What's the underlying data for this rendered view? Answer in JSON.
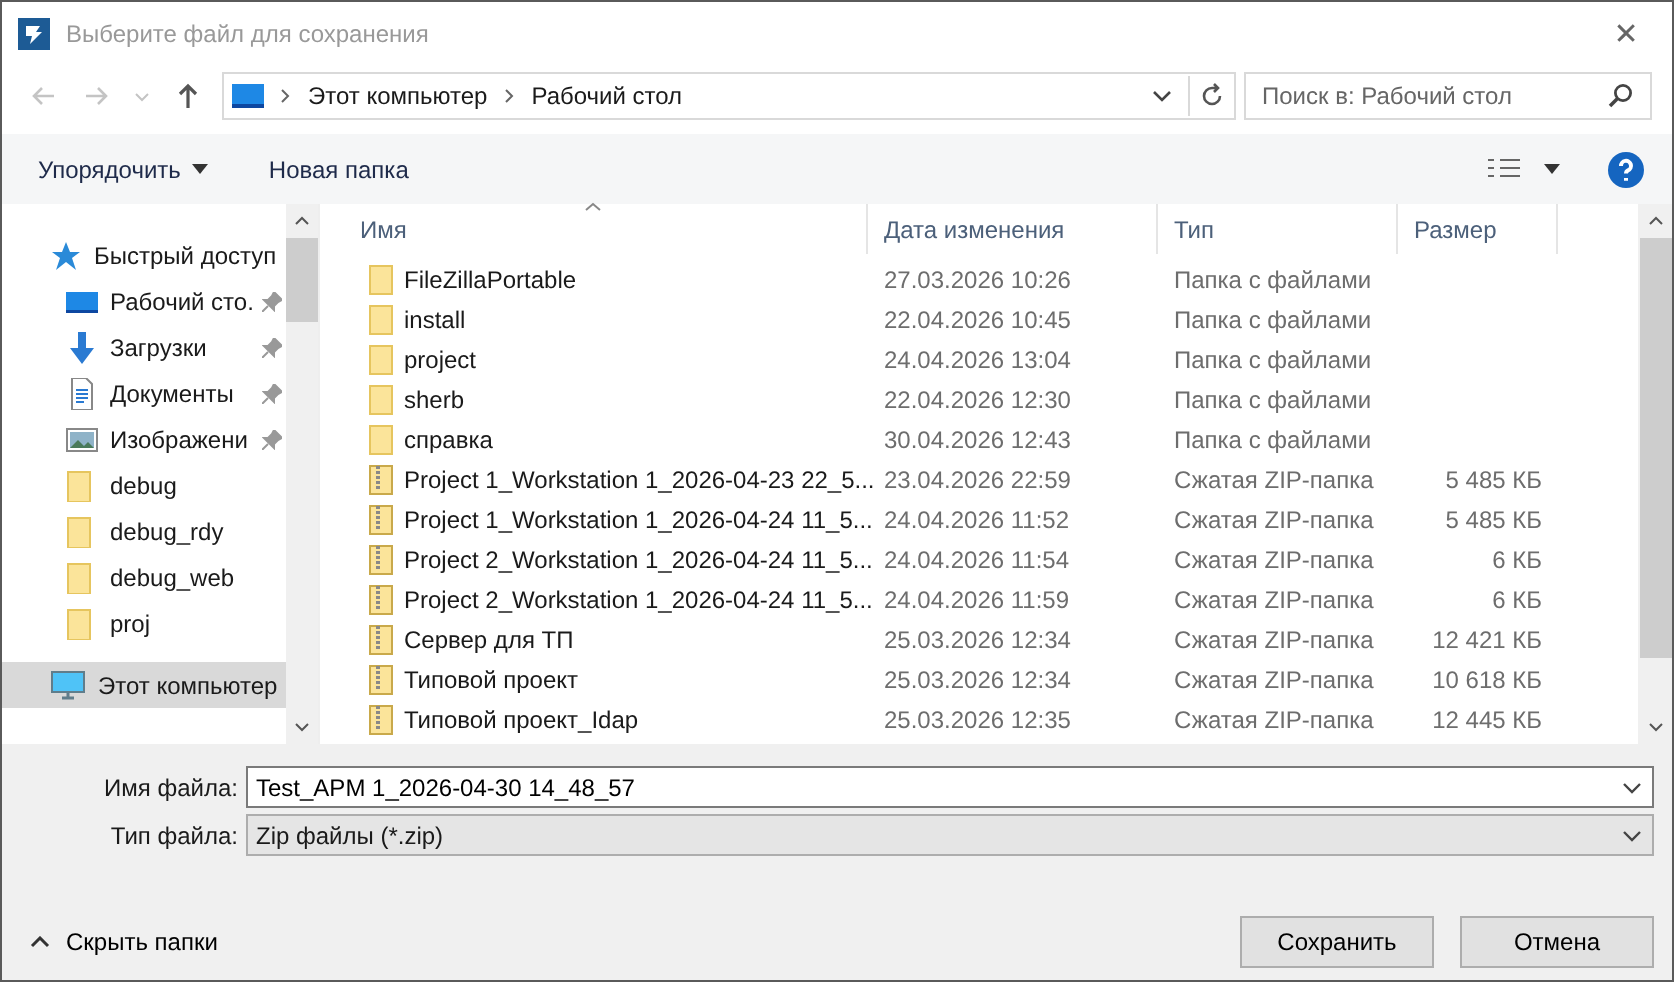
{
  "window": {
    "title": "Выберите файл для сохранения",
    "close": "✕"
  },
  "address": {
    "path": [
      "Этот компьютер",
      "Рабочий стол"
    ]
  },
  "search": {
    "placeholder": "Поиск в: Рабочий стол"
  },
  "toolbar": {
    "organize": "Упорядочить",
    "new_folder": "Новая папка"
  },
  "sidebar": {
    "items": [
      {
        "label": "Быстрый доступ",
        "kind": "star",
        "pinned": false,
        "selected": false
      },
      {
        "label": "Рабочий сто.",
        "kind": "desktop",
        "pinned": true,
        "selected": false
      },
      {
        "label": "Загрузки",
        "kind": "download",
        "pinned": true,
        "selected": false
      },
      {
        "label": "Документы",
        "kind": "document",
        "pinned": true,
        "selected": false
      },
      {
        "label": "Изображени",
        "kind": "image",
        "pinned": true,
        "selected": false
      },
      {
        "label": "debug",
        "kind": "folder",
        "pinned": false,
        "selected": false
      },
      {
        "label": "debug_rdy",
        "kind": "folder",
        "pinned": false,
        "selected": false
      },
      {
        "label": "debug_web",
        "kind": "folder",
        "pinned": false,
        "selected": false
      },
      {
        "label": "proj",
        "kind": "folder",
        "pinned": false,
        "selected": false
      },
      {
        "label": "Этот компьютер",
        "kind": "computer",
        "pinned": false,
        "selected": true
      }
    ]
  },
  "table": {
    "columns": [
      "Имя",
      "Дата изменения",
      "Тип",
      "Размер"
    ],
    "rows": [
      {
        "kind": "folder",
        "name": "FileZillaPortable",
        "date": "27.03.2026 10:26",
        "type": "Папка с файлами"
      },
      {
        "kind": "folder",
        "name": "install",
        "date": "22.04.2026 10:45",
        "type": "Папка с файлами"
      },
      {
        "kind": "folder",
        "name": "project",
        "date": "24.04.2026 13:04",
        "type": "Папка с файлами"
      },
      {
        "kind": "folder",
        "name": "sherb",
        "date": "22.04.2026 12:30",
        "type": "Папка с файлами"
      },
      {
        "kind": "folder",
        "name": "справка",
        "date": "30.04.2026 12:43",
        "type": "Папка с файлами"
      },
      {
        "kind": "zip",
        "name": "Project 1_Workstation 1_2026-04-23 22_5...",
        "date": "23.04.2026 22:59",
        "type": "Сжатая ZIP-папка",
        "size": "5 485 КБ"
      },
      {
        "kind": "zip",
        "name": "Project 1_Workstation 1_2026-04-24 11_5...",
        "date": "24.04.2026 11:52",
        "type": "Сжатая ZIP-папка",
        "size": "5 485 КБ"
      },
      {
        "kind": "zip",
        "name": "Project 2_Workstation 1_2026-04-24 11_5...",
        "date": "24.04.2026 11:54",
        "type": "Сжатая ZIP-папка",
        "size": "6 КБ"
      },
      {
        "kind": "zip",
        "name": "Project 2_Workstation 1_2026-04-24 11_5...",
        "date": "24.04.2026 11:59",
        "type": "Сжатая ZIP-папка",
        "size": "6 КБ"
      },
      {
        "kind": "zip",
        "name": "Сервер для ТП",
        "date": "25.03.2026 12:34",
        "type": "Сжатая ZIP-папка",
        "size": "12 421 КБ"
      },
      {
        "kind": "zip",
        "name": "Типовой проект",
        "date": "25.03.2026 12:34",
        "type": "Сжатая ZIP-папка",
        "size": "10 618 КБ"
      },
      {
        "kind": "zip",
        "name": "Типовой проект_Idap",
        "date": "25.03.2026 12:35",
        "type": "Сжатая ZIP-папка",
        "size": "12 445 КБ"
      }
    ]
  },
  "file_name": {
    "label": "Имя файла:",
    "value": "Test_APM 1_2026-04-30 14_48_57"
  },
  "file_type": {
    "label": "Тип файла:",
    "value": "Zip файлы (*.zip)"
  },
  "footer": {
    "hide_folders": "Скрыть папки",
    "save": "Сохранить",
    "cancel": "Отмена"
  }
}
